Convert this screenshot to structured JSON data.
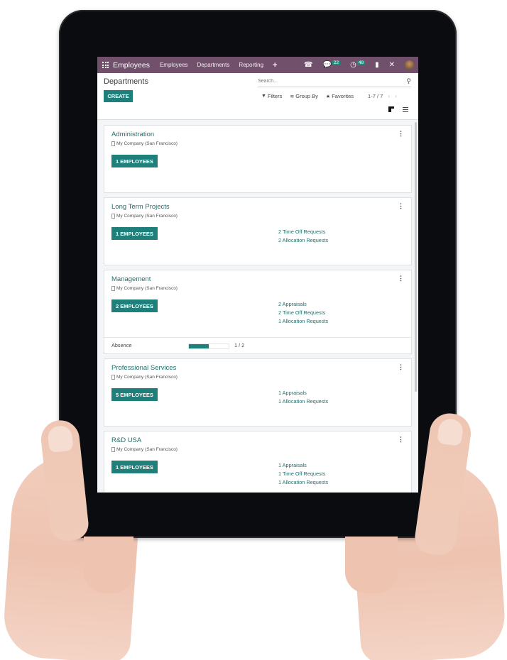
{
  "navbar": {
    "app_name": "Employees",
    "menu": [
      "Employees",
      "Departments",
      "Reporting"
    ],
    "add_label": "+",
    "icons": {
      "phone": "phone-icon",
      "chat": "chat-icon",
      "activity": "clock-icon",
      "document": "document-icon",
      "tools": "tools-icon"
    },
    "chat_badge": "22",
    "activity_badge": "48"
  },
  "control": {
    "title": "Departments",
    "search_placeholder": "Search...",
    "create_label": "CREATE",
    "filters_label": "Filters",
    "groupby_label": "Group By",
    "favorites_label": "Favorites",
    "pager": "1-7 / 7"
  },
  "departments": [
    {
      "name": "Administration",
      "company": "My Company (San Francisco)",
      "employees_label": "1 EMPLOYEES",
      "stats": []
    },
    {
      "name": "Long Term Projects",
      "company": "My Company (San Francisco)",
      "employees_label": "1 EMPLOYEES",
      "stats": [
        "2 Time Off Requests",
        "2 Allocation Requests"
      ]
    },
    {
      "name": "Management",
      "company": "My Company (San Francisco)",
      "employees_label": "2 EMPLOYEES",
      "stats": [
        "2 Appraisals",
        "2 Time Off Requests",
        "1 Allocation Requests"
      ],
      "absence": {
        "label": "Absence",
        "value": 1,
        "max": 2,
        "text": "1 / 2"
      }
    },
    {
      "name": "Professional Services",
      "company": "My Company (San Francisco)",
      "employees_label": "5 EMPLOYEES",
      "stats": [
        "1 Appraisals",
        "1 Allocation Requests"
      ]
    },
    {
      "name": "R&D USA",
      "company": "My Company (San Francisco)",
      "employees_label": "1 EMPLOYEES",
      "stats": [
        "1 Appraisals",
        "1 Time Off Requests",
        "1 Allocation Requests"
      ]
    }
  ],
  "colors": {
    "navbar": "#71506b",
    "primary": "#1f7f7a",
    "link": "#1f6f6b",
    "badge": "#1e8a7e"
  }
}
